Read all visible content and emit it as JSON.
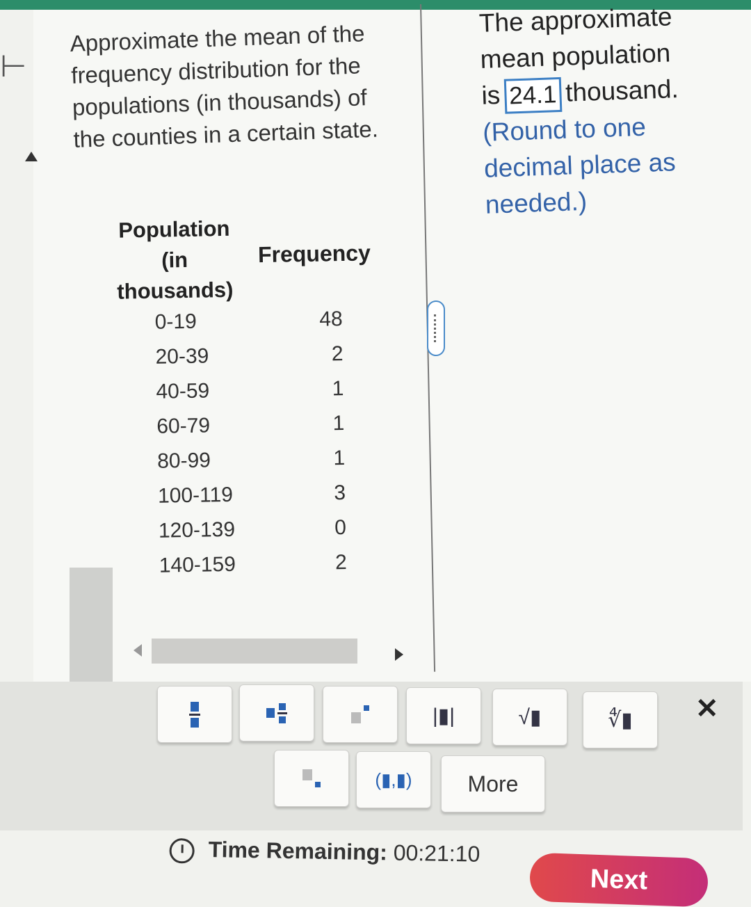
{
  "question": {
    "text": "Approximate the mean of the frequency distribution for the populations (in thousands) of the counties in a certain state."
  },
  "table": {
    "col1_header": "Population (in thousands)",
    "col2_header": "Frequency",
    "rows": [
      {
        "range": "0-19",
        "freq": "48"
      },
      {
        "range": "20-39",
        "freq": "2"
      },
      {
        "range": "40-59",
        "freq": "1"
      },
      {
        "range": "60-79",
        "freq": "1"
      },
      {
        "range": "80-99",
        "freq": "1"
      },
      {
        "range": "100-119",
        "freq": "3"
      },
      {
        "range": "120-139",
        "freq": "0"
      },
      {
        "range": "140-159",
        "freq": "2"
      }
    ]
  },
  "answer": {
    "line1": "The approximate",
    "line2": "mean population",
    "prefix": "is",
    "value": "24.1",
    "suffix": "thousand.",
    "note_line1": "(Round to one",
    "note_line2": "decimal place as",
    "note_line3": "needed.)"
  },
  "toolbar": {
    "more_label": "More",
    "interval_label": "(▮,▮)",
    "abs_label": "|▮|",
    "sqrt_label": "√▮",
    "nthroot_label": "∜▮",
    "close_label": "✕"
  },
  "footer": {
    "timer_label": "Time Remaining:",
    "timer_value": "00:21:10",
    "next_label": "Next"
  },
  "colors": {
    "accent_blue": "#3c7fc4",
    "next_button": "#d63b5e",
    "top_bar": "#2c8d6a"
  }
}
